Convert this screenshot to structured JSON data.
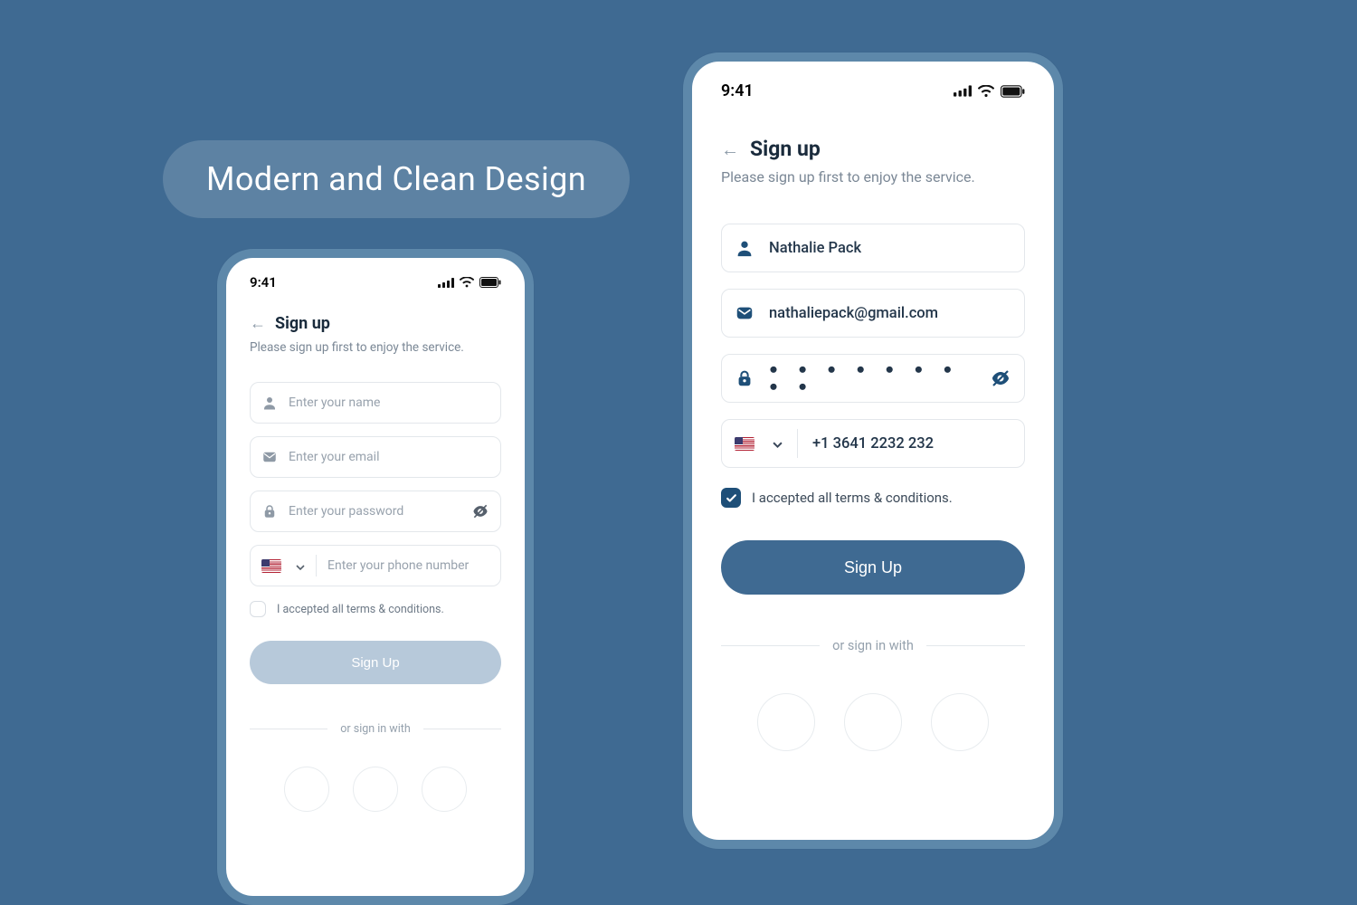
{
  "tagline": "Modern and Clean Design",
  "status_time": "9:41",
  "header": {
    "title": "Sign up",
    "subtitle": "Please sign up first to enjoy the service."
  },
  "placeholders": {
    "name": "Enter your name",
    "email": "Enter your email",
    "password": "Enter your password",
    "phone": "Enter your phone number"
  },
  "filled": {
    "name": "Nathalie Pack",
    "email": "nathaliepack@gmail.com",
    "password_mask": "● ● ● ● ● ● ● ● ●",
    "phone": "+1 3641 2232 232"
  },
  "terms_label": "I accepted all terms & conditions.",
  "signup_button": "Sign Up",
  "or_label": "or sign in with",
  "colors": {
    "bg": "#3f6a92",
    "accent_dark": "#1e4f78",
    "primary_disabled": "#b7c9da",
    "primary_enabled": "#3f6a92"
  }
}
